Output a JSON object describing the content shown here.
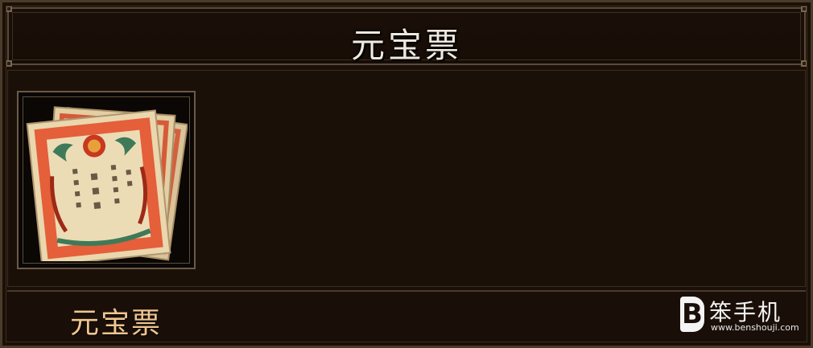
{
  "window": {
    "title": "元宝票"
  },
  "item": {
    "name": "元宝票",
    "icon": "banknote-icon"
  },
  "watermark": {
    "logo_letter": "B",
    "brand": "笨手机",
    "url": "www.benshouji.com"
  },
  "colors": {
    "panel_bg": "#1b1008",
    "frame": "#4a3b2b",
    "title_text": "#efe8dc",
    "item_name": "#f0c590"
  }
}
